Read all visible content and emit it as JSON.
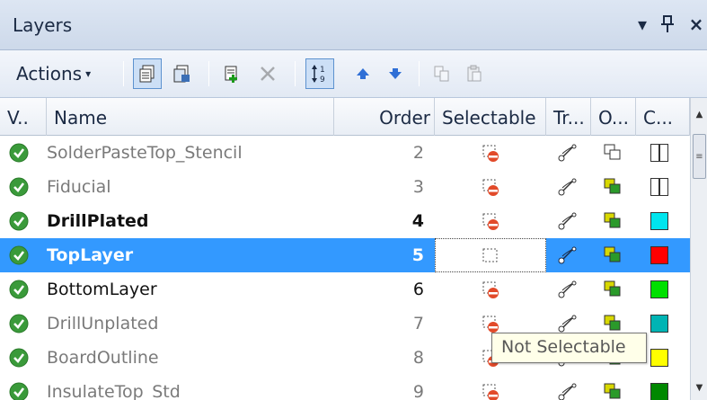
{
  "panel": {
    "title": "Layers",
    "menu_glyph": "▾",
    "pin_glyph": "ꟸ",
    "close_glyph": "×"
  },
  "toolbar": {
    "actions_label": "Actions",
    "actions_caret": "▾"
  },
  "columns": {
    "visible": "V..",
    "name": "Name",
    "order": "Order",
    "selectable": "Selectable",
    "transparency": "Tr...",
    "outline": "O...",
    "color": "C..."
  },
  "rows": [
    {
      "name": "SolderPasteTop_Stencil",
      "order": "2",
      "style": "dim",
      "color": "#ffffff"
    },
    {
      "name": "Fiducial",
      "order": "3",
      "style": "dim",
      "color": "#ffffff"
    },
    {
      "name": "DrillPlated",
      "order": "4",
      "style": "bold",
      "color": "#00e5ee"
    },
    {
      "name": "TopLayer",
      "order": "5",
      "style": "bold",
      "color": "#ff0000",
      "selected": true
    },
    {
      "name": "BottomLayer",
      "order": "6",
      "style": "normal",
      "color": "#00e000"
    },
    {
      "name": "DrillUnplated",
      "order": "7",
      "style": "dim",
      "color": "#00b4b4"
    },
    {
      "name": "BoardOutline",
      "order": "8",
      "style": "dim",
      "color": "#ffff00"
    },
    {
      "name": "InsulateTop_Std",
      "order": "9",
      "style": "dim",
      "color": "#008800"
    }
  ],
  "tooltip": {
    "text": "Not Selectable"
  },
  "colors": {
    "selection": "#3399ff",
    "header_bg": "#dde6f3"
  }
}
